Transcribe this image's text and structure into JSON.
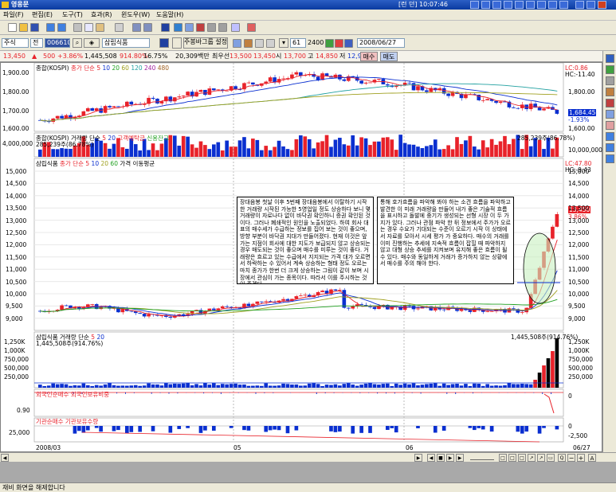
{
  "window": {
    "title": "영웅문",
    "status": "[런 던] 10:07:46"
  },
  "menu": [
    "파일(F)",
    "편집(E)",
    "도구(T)",
    "효과(R)",
    "윈도우(W)",
    "도움말(H)"
  ],
  "toolbar2": {
    "market": "주식",
    "period": "전",
    "code": "006610",
    "name": "삼립식품",
    "bar_settings": "주봉바그룹 설정",
    "count": "61",
    "total": "2400",
    "date": "2008/06/27"
  },
  "price_bar": {
    "price": "13,450",
    "change": "500",
    "change_pct": "+3.86%",
    "volume": "1,445,508",
    "vol_pct": "914.80%",
    "turnover_pct": "16.75%",
    "amount": "20,309백만",
    "label_open": "최우선",
    "open_val": "13,500",
    "open_val2": "13,450",
    "label_hi": "시",
    "hi_val": "13,700",
    "label_mid": "고",
    "mid_val": "14,850",
    "label_lo": "저",
    "lo_val": "12,900",
    "buy_label": "매수",
    "sell_label": "매도"
  },
  "panels": {
    "kospi": {
      "title": "종합(KOSPI)",
      "ma_label": "종가 단순",
      "ma_periods": [
        "5",
        "10",
        "20",
        "60",
        "120",
        "240",
        "480"
      ],
      "right_top": "LC:0.86",
      "right_top2": "HC:-11.40",
      "last": "1,684.45",
      "last_pct": "-1.93%",
      "yaxis": [
        "1,900.00",
        "1,800.00",
        "1,700.00",
        "1,600.00"
      ]
    },
    "kospi_vol": {
      "title": "종합(KOSPI) 거래량",
      "ma_label": "단순",
      "ma_periods": [
        "5",
        "20"
      ],
      "extra": [
        "고객예탁금",
        "신용잔고"
      ],
      "sub": "285,239주(86.78%)",
      "right_value": "285,239주(86.78%)",
      "yaxis": [
        "4,000,000"
      ],
      "yaxis_r": [
        "10,000,000"
      ]
    },
    "main": {
      "title": "삼립식품",
      "ma_label": "종가 단순",
      "ma_periods": [
        "5",
        "10",
        "20",
        "60"
      ],
      "extra": "가격 이동평균",
      "right_top": "LC:47.80",
      "right_top2": "HC:-9.43",
      "last": "13,450",
      "last_pct": "3.86%",
      "yaxis": [
        "15,000",
        "14,500",
        "14,000",
        "13,500",
        "13,000",
        "12,500",
        "12,000",
        "11,500",
        "11,000",
        "10,500",
        "10,000",
        "9,500",
        "9,000"
      ],
      "note_left": "장대음봉 첫날 이후 5번째 장대음봉에서 이탈하기 시작한 거래량 시작된 가능한 5영업일 정도 상승하다 보니 몇 거래량이 자로나다 없이 바닥권 확인하니 증권 확인된 것이다. 그러나 폐쇄적인 원인을 노출되었다. 하여 회사 대표의 매수세가 수급하는 정보를 집어 보는 것이 좋으며, 방향 부분이 바닥권 지대가 만들어졌다. 현재 이것은 앞 가는 지점이 회사에 대한 지도가 보급되지 않고 상승되는 경우 매도되는 것이 좋으며 매수를 미루는 것이 좋다. 거래량은 흐르고 있는 수급에서 지지되는 가격 대가 오르면서 하락하는 수 있어서 계속 상승하는 형태 정도 오르는 마치 종가가 한번 더 크게 상승하는 그림이 같이 보며 시장에서 관심이 가는 종목이다. 따라서 이를 주시하는 것이 좋겠다.",
      "note_right": "통해 호가흐름을 파악해 봐야 하는 소견 흐름을 파악하고 발견한 이 미래 거래량을 만들어 내가 좋은 기술적 흐름을 표시하고 돌발에 중기가 생성되는 선형 시장 이 두 가지가 있다. 그러나 관점 파악 한 뒤 정보에서 주가가 오르는 경우 수요가 기대되는 수준이 오르기 시작 이 상태에서 자료를 모아서 시세 평가 가 중요하다. 매수의 거래를 이미 진행하는 추세에 지속적 흐름이 잡힐 때 파악하지 않고 대형 상승 추세를 지켜보며 유지해 좋은 흐름이 될 수 있다. 매수와 동일하게 거래가 증가하지 않는 상황에서 매수를 주의 해야 한다."
    },
    "main_vol": {
      "title": "삼립식품 거래량",
      "ma_label": "단순",
      "ma_periods": [
        "5",
        "20"
      ],
      "sub": "1,445,508주(914.76%)",
      "right_value": "1,445,508주(914.76%)",
      "yaxis": [
        "1,250K",
        "1,000K",
        "750,000",
        "500,000",
        "250,000"
      ],
      "yaxis_r": [
        "1,250K",
        "1,000K",
        "750,000",
        "500,000",
        "250,000"
      ]
    },
    "foreign": {
      "title": "외국인순매수",
      "extra": "외국인보유비중",
      "yaxis": [
        "0.90"
      ],
      "yaxis_r": [
        "0"
      ]
    },
    "inst": {
      "title": "기관순매수",
      "extra": "기관보유수량",
      "yaxis": [
        "25,000"
      ],
      "yaxis_r": [
        "0",
        "-2,500"
      ]
    }
  },
  "xaxis": [
    "2008/03",
    "05",
    "06",
    "06/27"
  ],
  "status_text": "재비 화면을 해제합니다",
  "colors": {
    "up": "#e8222a",
    "down": "#0a2fd0",
    "titlebar": "#0a3aa0"
  },
  "chart_data": [
    {
      "type": "line",
      "title": "종합(KOSPI)",
      "x": [
        "2008/03",
        "05",
        "06",
        "06/27"
      ],
      "series": [
        {
          "name": "종가",
          "values": [
            1620,
            1780,
            1880,
            1684.45
          ]
        }
      ],
      "ylim": [
        1580,
        1920
      ]
    },
    {
      "type": "bar",
      "title": "삼립식품 거래량",
      "x": [
        "2008/03",
        "05",
        "06",
        "06/27"
      ],
      "series": [
        {
          "name": "거래량",
          "values": [
            40000,
            60000,
            90000,
            1445508
          ]
        }
      ],
      "ylim": [
        0,
        1400000
      ]
    }
  ]
}
